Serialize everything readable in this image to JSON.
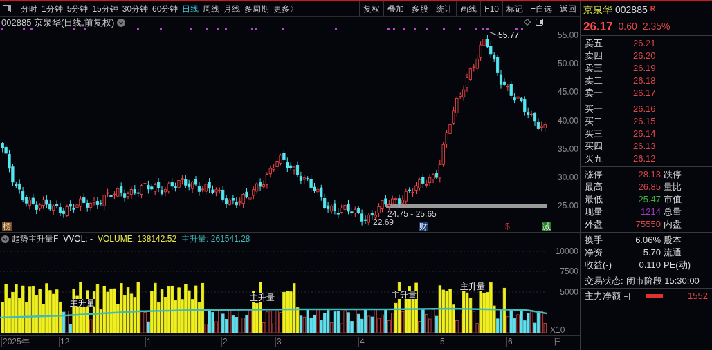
{
  "toolbar": {
    "periods": [
      {
        "label": "分时",
        "selected": false
      },
      {
        "label": "1分钟",
        "selected": false
      },
      {
        "label": "5分钟",
        "selected": false
      },
      {
        "label": "15分钟",
        "selected": false
      },
      {
        "label": "30分钟",
        "selected": false
      },
      {
        "label": "60分钟",
        "selected": false
      },
      {
        "label": "日线",
        "selected": true
      },
      {
        "label": "周线",
        "selected": false
      },
      {
        "label": "月线",
        "selected": false
      },
      {
        "label": "多周期",
        "selected": false
      },
      {
        "label": "更多〉",
        "selected": false
      }
    ],
    "actions": [
      "复权",
      "叠加",
      "多股",
      "统计",
      "画线",
      "F10",
      "标记",
      "+自选",
      "返回"
    ]
  },
  "chart": {
    "title": "002885 京泉华(日线,前复权)",
    "price_axis": [
      "55.00",
      "50.00",
      "45.00",
      "40.00",
      "35.00",
      "30.00",
      "25.00"
    ],
    "high_label": "55.77",
    "low_label": "←22.69",
    "range_label": "24.75 - 25.65",
    "markers": [
      {
        "text": "榜",
        "kind": "rank"
      },
      {
        "text": "财",
        "kind": "finance"
      },
      {
        "text": "$",
        "kind": "dividend"
      },
      {
        "text": "减",
        "kind": "reduce"
      }
    ]
  },
  "indicator": {
    "name": "趋势主升量F",
    "fields": [
      {
        "text": "VVOL: -",
        "color": "#e6e6e6"
      },
      {
        "text": "VOLUME: 138142.52",
        "color": "#e6e64a"
      },
      {
        "text": "主升量: 261541.28",
        "color": "#3fb8b8"
      }
    ],
    "axis": [
      "10000",
      "7500",
      "5000"
    ],
    "unit": "X10",
    "signals": [
      "主升量",
      "主升量",
      "主升量",
      "主升量"
    ]
  },
  "date_axis": [
    "2025年",
    "12",
    "1",
    "2",
    "3",
    "4",
    "5",
    "6",
    "日"
  ],
  "sidebar": {
    "name": "京泉华",
    "code": "002885",
    "badge": "R",
    "price": "26.17",
    "change": "0.60",
    "change_pct": "2.35%",
    "asks": [
      {
        "label": "卖五",
        "price": "26.21"
      },
      {
        "label": "卖四",
        "price": "26.20"
      },
      {
        "label": "卖三",
        "price": "26.19"
      },
      {
        "label": "卖二",
        "price": "26.18"
      },
      {
        "label": "卖一",
        "price": "26.17"
      }
    ],
    "bids": [
      {
        "label": "买一",
        "price": "26.16"
      },
      {
        "label": "买二",
        "price": "26.15"
      },
      {
        "label": "买三",
        "price": "26.14"
      },
      {
        "label": "买四",
        "price": "26.13"
      },
      {
        "label": "买五",
        "price": "26.12"
      }
    ],
    "stats": [
      {
        "label": "涨停",
        "value": "28.13",
        "color": "#d84848",
        "label2": "跌停"
      },
      {
        "label": "最高",
        "value": "26.85",
        "color": "#d84848",
        "label2": "量比"
      },
      {
        "label": "最低",
        "value": "25.47",
        "color": "#3cb43c",
        "label2": "市值"
      },
      {
        "label": "现量",
        "value": "1214",
        "color": "#a040c0",
        "label2": "总量"
      },
      {
        "label": "外盘",
        "value": "75550",
        "color": "#d84848",
        "label2": "内盘"
      }
    ],
    "fundamentals": [
      {
        "label": "换手",
        "value": "6.06%",
        "label2": "股本"
      },
      {
        "label": "净资",
        "value": "5.70",
        "label2": "流通"
      },
      {
        "label": "收益(-)",
        "value": "0.110",
        "label2": "PE(动)"
      }
    ],
    "status": {
      "label": "交易状态:",
      "value": "闭市阶段 15:30:00"
    },
    "net_flow": {
      "label": "主力净额",
      "value": "1552"
    }
  }
}
